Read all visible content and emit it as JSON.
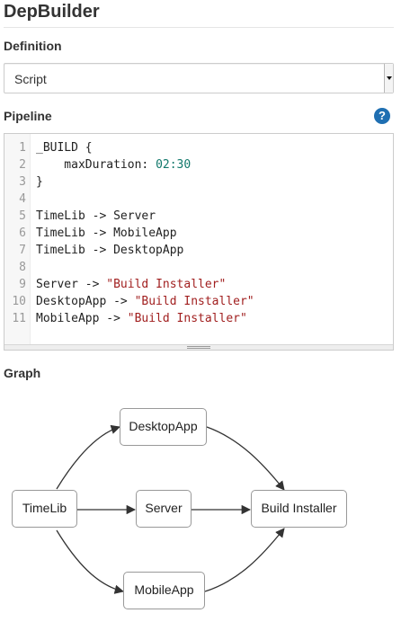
{
  "app": {
    "title": "DepBuilder"
  },
  "definition": {
    "label": "Definition",
    "selected": "Script"
  },
  "pipeline": {
    "label": "Pipeline",
    "help_icon": "question-circle-icon",
    "help_glyph": "?",
    "lines": [
      {
        "n": "1",
        "tokens": [
          {
            "t": "_BUILD {",
            "k": "plain"
          }
        ]
      },
      {
        "n": "2",
        "tokens": [
          {
            "t": "    maxDuration: ",
            "k": "plain"
          },
          {
            "t": "02:30",
            "k": "num"
          }
        ]
      },
      {
        "n": "3",
        "tokens": [
          {
            "t": "}",
            "k": "plain"
          }
        ]
      },
      {
        "n": "4",
        "tokens": []
      },
      {
        "n": "5",
        "tokens": [
          {
            "t": "TimeLib -> Server",
            "k": "plain"
          }
        ]
      },
      {
        "n": "6",
        "tokens": [
          {
            "t": "TimeLib -> MobileApp",
            "k": "plain"
          }
        ]
      },
      {
        "n": "7",
        "tokens": [
          {
            "t": "TimeLib -> DesktopApp",
            "k": "plain"
          }
        ]
      },
      {
        "n": "8",
        "tokens": []
      },
      {
        "n": "9",
        "tokens": [
          {
            "t": "Server -> ",
            "k": "plain"
          },
          {
            "t": "\"Build Installer\"",
            "k": "str"
          }
        ]
      },
      {
        "n": "10",
        "tokens": [
          {
            "t": "DesktopApp -> ",
            "k": "plain"
          },
          {
            "t": "\"Build Installer\"",
            "k": "str"
          }
        ]
      },
      {
        "n": "11",
        "tokens": [
          {
            "t": "MobileApp -> ",
            "k": "plain"
          },
          {
            "t": "\"Build Installer\"",
            "k": "str"
          }
        ]
      }
    ]
  },
  "graph": {
    "label": "Graph",
    "nodes": [
      {
        "id": "timelib",
        "label": "TimeLib"
      },
      {
        "id": "desktopapp",
        "label": "DesktopApp"
      },
      {
        "id": "server",
        "label": "Server"
      },
      {
        "id": "mobileapp",
        "label": "MobileApp"
      },
      {
        "id": "installer",
        "label": "Build Installer"
      }
    ],
    "edges": [
      [
        "timelib",
        "desktopapp"
      ],
      [
        "timelib",
        "server"
      ],
      [
        "timelib",
        "mobileapp"
      ],
      [
        "desktopapp",
        "installer"
      ],
      [
        "server",
        "installer"
      ],
      [
        "mobileapp",
        "installer"
      ]
    ]
  }
}
